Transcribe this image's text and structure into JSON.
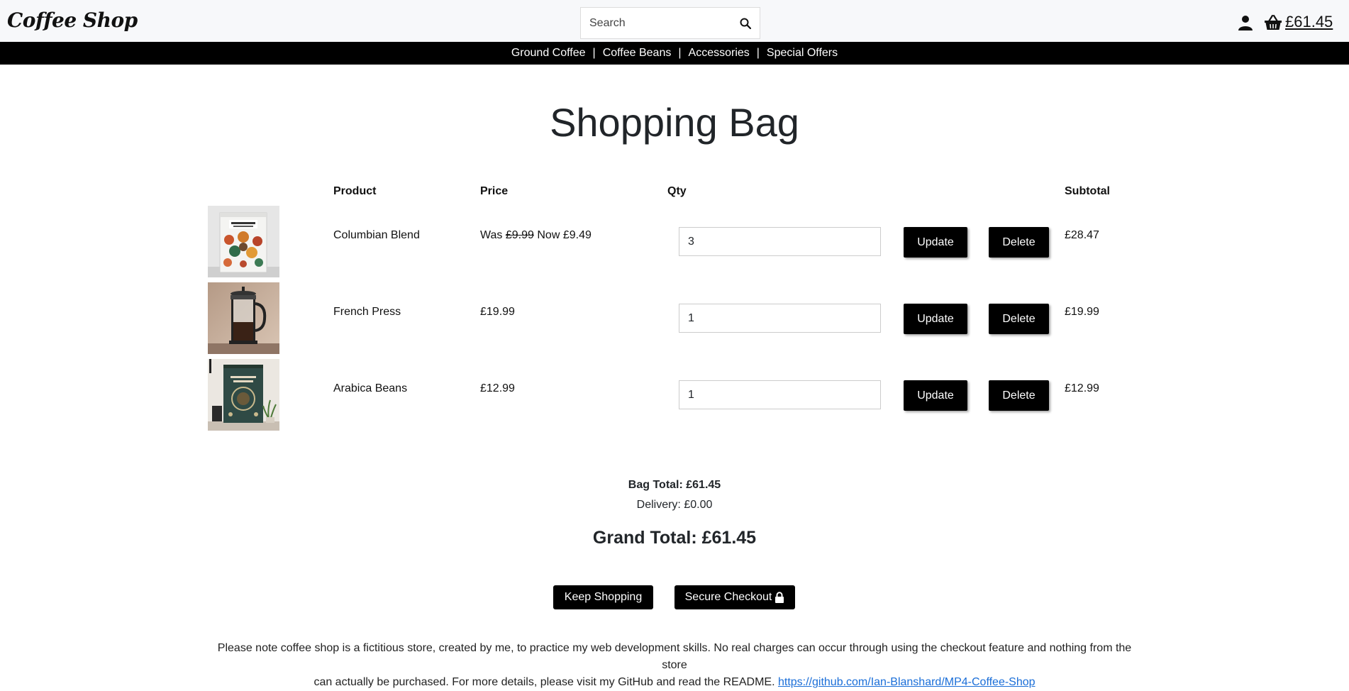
{
  "header": {
    "logo": "Coffee Shop",
    "search_placeholder": "Search",
    "search_icon": "search-icon",
    "account_icon": "user-icon",
    "cart_icon": "basket-icon",
    "cart_total": "£61.45"
  },
  "nav": {
    "items": [
      "Ground Coffee",
      "Coffee Beans",
      "Accessories",
      "Special Offers"
    ],
    "separator": "|"
  },
  "page_title": "Shopping Bag",
  "table": {
    "headers": {
      "product": "Product",
      "price": "Price",
      "qty": "Qty",
      "subtotal": "Subtotal"
    },
    "rows": [
      {
        "image": "colombian-blend-bag-image",
        "product": "Columbian Blend",
        "price_was_label": "Was",
        "price_was": "£9.99",
        "price_now_label": "Now",
        "price_now": "£9.49",
        "qty": "3",
        "update_label": "Update",
        "delete_label": "Delete",
        "subtotal": "£28.47"
      },
      {
        "image": "french-press-image",
        "product": "French Press",
        "price": "£19.99",
        "qty": "1",
        "update_label": "Update",
        "delete_label": "Delete",
        "subtotal": "£19.99"
      },
      {
        "image": "arabica-beans-bag-image",
        "product": "Arabica Beans",
        "price": "£12.99",
        "qty": "1",
        "update_label": "Update",
        "delete_label": "Delete",
        "subtotal": "£12.99"
      }
    ]
  },
  "totals": {
    "bag_total": "Bag Total: £61.45",
    "delivery": "Delivery: £0.00",
    "grand_total": "Grand Total: £61.45"
  },
  "actions": {
    "keep_shopping": "Keep Shopping",
    "secure_checkout": "Secure Checkout",
    "lock_icon": "lock-icon"
  },
  "disclaimer": {
    "text_line1": "Please note coffee shop is a fictitious store, created by me, to practice my web development skills. No real charges can occur through using the checkout feature and nothing from the store",
    "text_line2": "can actually be purchased. For more details, please visit my GitHub and read the README.",
    "link": "https://github.com/Ian-Blanshard/MP4-Coffee-Shop"
  },
  "colors": {
    "header_bg": "#f7f8fa",
    "nav_bg": "#000000",
    "button_bg": "#000000",
    "link": "#1a6ed8"
  }
}
